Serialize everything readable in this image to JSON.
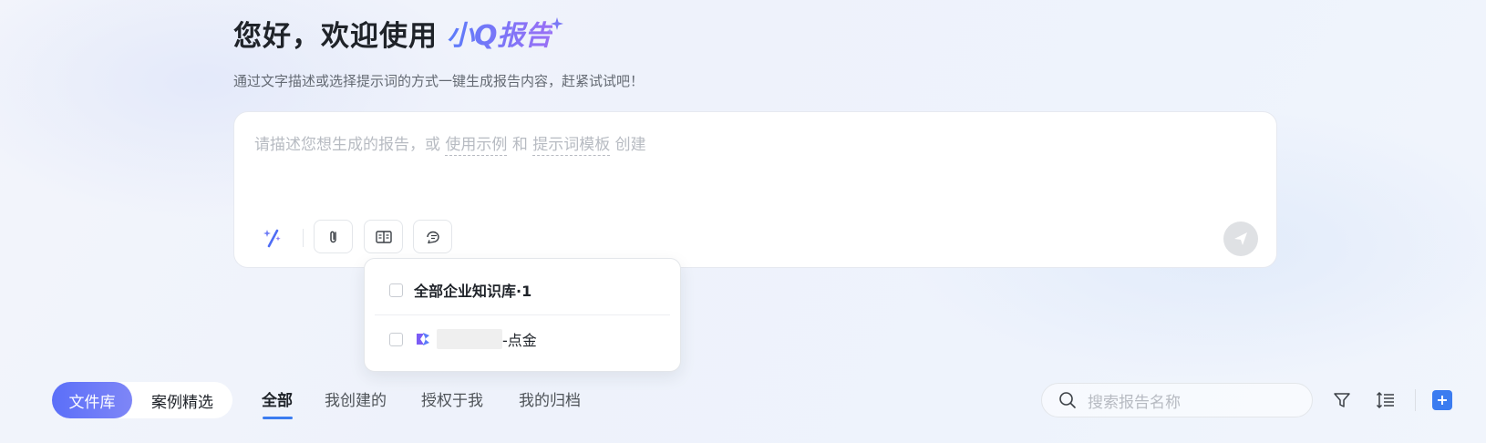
{
  "header": {
    "greeting": "您好，欢迎使用",
    "brand": "小Q报告",
    "subtitle": "通过文字描述或选择提示词的方式一键生成报告内容，赶紧试试吧！"
  },
  "prompt": {
    "placeholder_prefix": "请描述您想生成的报告，或",
    "link_examples": "使用示例",
    "connector": "和",
    "link_templates": "提示词模板",
    "placeholder_suffix": "创建",
    "tools": [
      "magic-wand-icon",
      "attachment-icon",
      "knowledge-base-icon",
      "prompt-icon"
    ],
    "send_icon": "send-icon"
  },
  "knowledge_popup": {
    "all_label": "全部企业知识库·1",
    "item_suffix": "-点金",
    "all_checked": false,
    "item_checked": false
  },
  "bottom": {
    "segments": [
      "文件库",
      "案例精选"
    ],
    "active_segment": "文件库",
    "tabs": [
      "全部",
      "我创建的",
      "授权于我",
      "我的归档"
    ],
    "active_tab": "全部",
    "search_placeholder": "搜索报告名称",
    "icons": [
      "filter-icon",
      "sort-icon",
      "add-icon"
    ]
  },
  "colors": {
    "accent": "#3b7cf0",
    "brand_gradient_start": "#5b7cfa",
    "brand_gradient_end": "#9a6ff5",
    "segment_active": "#5b6ff8"
  }
}
